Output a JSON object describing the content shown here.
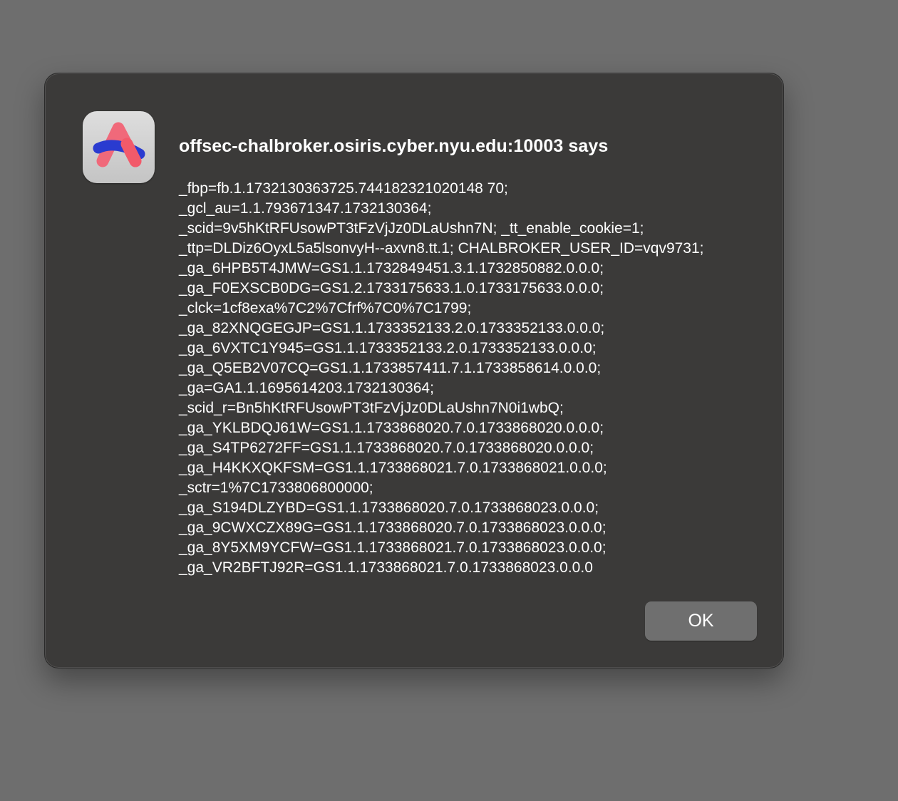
{
  "app_icon": {
    "name": "arc-browser-icon"
  },
  "dialog": {
    "title": "offsec-chalbroker.osiris.cyber.nyu.edu:10003 says",
    "message_lines": [
      "_fbp=fb.1.1732130363725.744182321020148 70;",
      "_gcl_au=1.1.793671347.1732130364;",
      "_scid=9v5hKtRFUsowPT3tFzVjJz0DLaUshn7N; _tt_enable_cookie=1;",
      "_ttp=DLDiz6OyxL5a5lsonvyH--axvn8.tt.1; CHALBROKER_USER_ID=vqv9731;",
      "_ga_6HPB5T4JMW=GS1.1.1732849451.3.1.1732850882.0.0.0;",
      "_ga_F0EXSCB0DG=GS1.2.1733175633.1.0.1733175633.0.0.0;",
      "_clck=1cf8exa%7C2%7Cfrf%7C0%7C1799;",
      "_ga_82XNQGEGJP=GS1.1.1733352133.2.0.1733352133.0.0.0;",
      "_ga_6VXTC1Y945=GS1.1.1733352133.2.0.1733352133.0.0.0;",
      "_ga_Q5EB2V07CQ=GS1.1.1733857411.7.1.1733858614.0.0.0;",
      "_ga=GA1.1.1695614203.1732130364;",
      "_scid_r=Bn5hKtRFUsowPT3tFzVjJz0DLaUshn7N0i1wbQ;",
      "_ga_YKLBDQJ61W=GS1.1.1733868020.7.0.1733868020.0.0.0;",
      "_ga_S4TP6272FF=GS1.1.1733868020.7.0.1733868020.0.0.0;",
      "_ga_H4KKXQKFSM=GS1.1.1733868021.7.0.1733868021.0.0.0;",
      "_sctr=1%7C1733806800000;",
      "_ga_S194DLZYBD=GS1.1.1733868020.7.0.1733868023.0.0.0;",
      "_ga_9CWXCZX89G=GS1.1.1733868020.7.0.1733868023.0.0.0;",
      "_ga_8Y5XM9YCFW=GS1.1.1733868021.7.0.1733868023.0.0.0;",
      "_ga_VR2BFTJ92R=GS1.1.1733868021.7.0.1733868023.0.0.0"
    ],
    "ok_label": "OK"
  },
  "colors": {
    "backdrop": "#6e6e6e",
    "dialog_background": "#3b3a39",
    "button_background": "#6f6f6f",
    "text": "#ffffff",
    "icon_red": "#f25a6a",
    "icon_blue": "#2f3fd8"
  }
}
